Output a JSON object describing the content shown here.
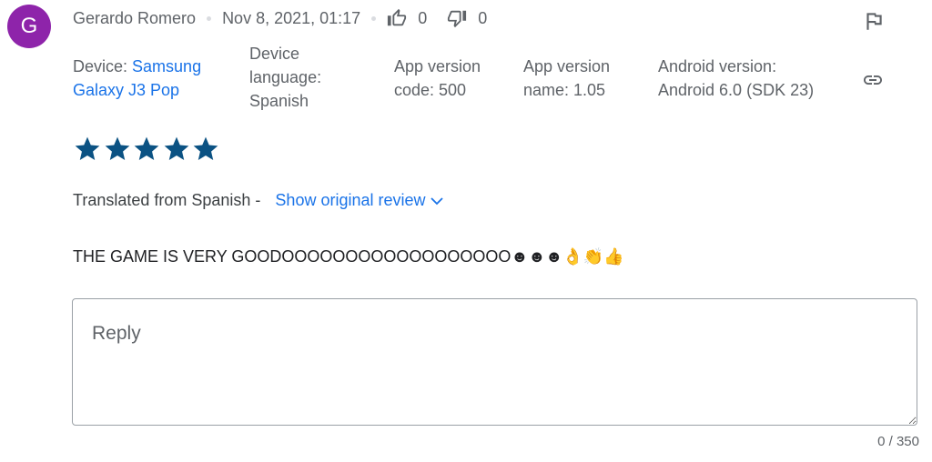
{
  "review": {
    "avatar_letter": "G",
    "author": "Gerardo Romero",
    "date": "Nov 8, 2021, 01:17",
    "thumbs_up_count": "0",
    "thumbs_down_count": "0",
    "device_label": "Device: ",
    "device_name_line1": "Samsung",
    "device_name_line2": "Galaxy J3 Pop",
    "device_language_line1": "Device",
    "device_language_line2": "language:",
    "device_language_line3": "Spanish",
    "app_version_code_line1": "App version",
    "app_version_code_line2": "code: 500",
    "app_version_name_line1": "App version",
    "app_version_name_line2": "name: 1.05",
    "android_version_line1": "Android version:",
    "android_version_line2": "Android 6.0 (SDK 23)",
    "star_rating": 5,
    "translated_from": "Translated from Spanish -",
    "show_original": "Show original review",
    "text": "THE GAME IS VERY GOODOOOOOOOOOOOOOOOOOO☻☻☻👌👏👍"
  },
  "reply": {
    "placeholder": "Reply",
    "counter": "0 / 350"
  },
  "colors": {
    "avatar": "#8e24aa",
    "link": "#1a73e8",
    "star": "#0b5283"
  },
  "icons": [
    "thumbs-up-icon",
    "thumbs-down-icon",
    "flag-icon",
    "link-icon",
    "star-icon",
    "chevron-down-icon"
  ]
}
